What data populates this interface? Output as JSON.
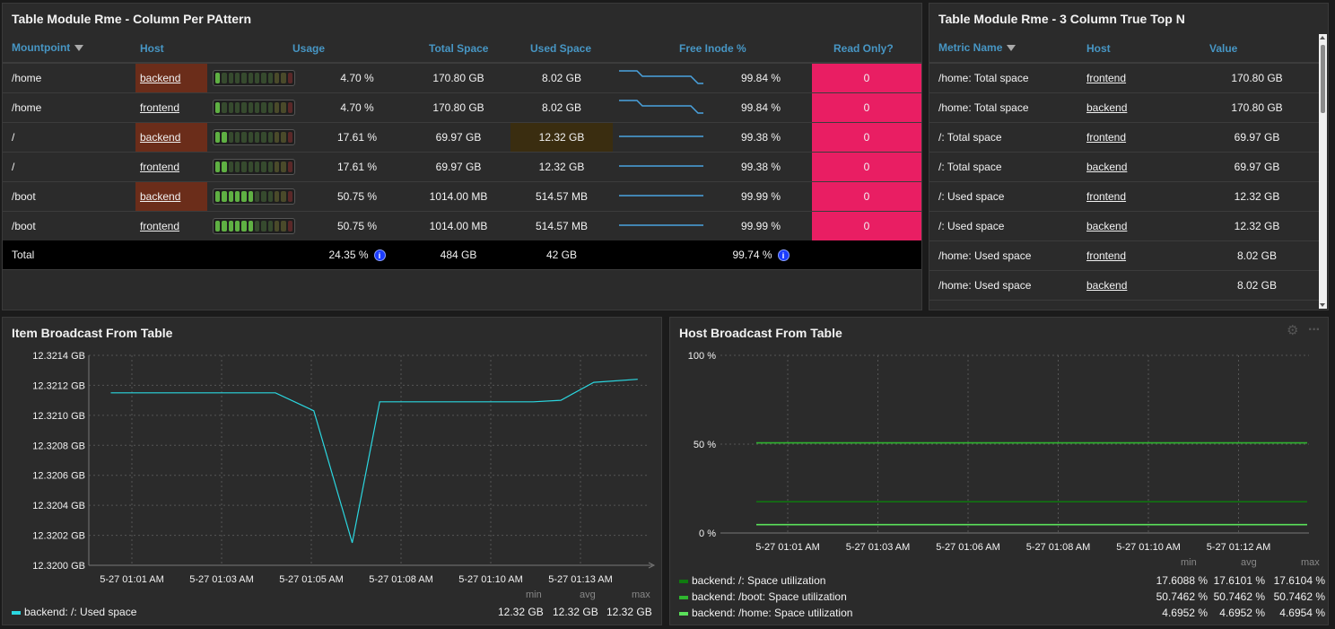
{
  "table1": {
    "title": "Table Module Rme - Column Per PAttern",
    "headers": [
      "Mountpoint",
      "Host",
      "Usage",
      "Total Space",
      "Used Space",
      "Free Inode %",
      "Read Only?"
    ],
    "rows": [
      {
        "mount": "/home",
        "host": "backend",
        "usage": "4.70 %",
        "usage_fraction": 0.047,
        "total": "170.80 GB",
        "used": "8.02 GB",
        "inode": "99.84 %",
        "ro": "0"
      },
      {
        "mount": "/home",
        "host": "frontend",
        "usage": "4.70 %",
        "usage_fraction": 0.047,
        "total": "170.80 GB",
        "used": "8.02 GB",
        "inode": "99.84 %",
        "ro": "0"
      },
      {
        "mount": "/",
        "host": "backend",
        "usage": "17.61 %",
        "usage_fraction": 0.1761,
        "total": "69.97 GB",
        "used": "12.32 GB",
        "inode": "99.38 %",
        "ro": "0"
      },
      {
        "mount": "/",
        "host": "frontend",
        "usage": "17.61 %",
        "usage_fraction": 0.1761,
        "total": "69.97 GB",
        "used": "12.32 GB",
        "inode": "99.38 %",
        "ro": "0"
      },
      {
        "mount": "/boot",
        "host": "backend",
        "usage": "50.75 %",
        "usage_fraction": 0.5075,
        "total": "1014.00 MB",
        "used": "514.57 MB",
        "inode": "99.99 %",
        "ro": "0"
      },
      {
        "mount": "/boot",
        "host": "frontend",
        "usage": "50.75 %",
        "usage_fraction": 0.5075,
        "total": "1014.00 MB",
        "used": "514.57 MB",
        "inode": "99.99 %",
        "ro": "0"
      }
    ],
    "total": {
      "label": "Total",
      "usage": "24.35 %",
      "total": "484 GB",
      "used": "42 GB",
      "inode": "99.74 %"
    },
    "info_glyph": "i",
    "colors": {
      "host_highlight": "#6b2d1a",
      "used_highlight": "#3a2d10",
      "readonly": "#e91e63",
      "header": "#4796c4",
      "sparkline": "#4aa3df"
    }
  },
  "table2": {
    "title": "Table Module Rme - 3 Column True Top N",
    "headers": [
      "Metric Name",
      "Host",
      "Value"
    ],
    "rows": [
      {
        "metric": "/home: Total space",
        "host": "frontend",
        "value": "170.80 GB"
      },
      {
        "metric": "/home: Total space",
        "host": "backend",
        "value": "170.80 GB"
      },
      {
        "metric": "/: Total space",
        "host": "frontend",
        "value": "69.97 GB"
      },
      {
        "metric": "/: Total space",
        "host": "backend",
        "value": "69.97 GB"
      },
      {
        "metric": "/: Used space",
        "host": "frontend",
        "value": "12.32 GB"
      },
      {
        "metric": "/: Used space",
        "host": "backend",
        "value": "12.32 GB"
      },
      {
        "metric": "/home: Used space",
        "host": "frontend",
        "value": "8.02 GB"
      },
      {
        "metric": "/home: Used space",
        "host": "backend",
        "value": "8.02 GB"
      }
    ]
  },
  "chart1": {
    "title": "Item Broadcast From Table",
    "legend_headers": {
      "min": "min",
      "avg": "avg",
      "max": "max"
    },
    "legend": [
      {
        "name": "backend: /: Used space",
        "color": "#2bd7e0",
        "min": "12.32 GB",
        "avg": "12.32 GB",
        "max": "12.32 GB"
      }
    ]
  },
  "chart2": {
    "title": "Host Broadcast From Table",
    "legend_headers": {
      "min": "min",
      "avg": "avg",
      "max": "max"
    },
    "legend": [
      {
        "name": "backend: /: Space utilization",
        "color": "#0f7a0f",
        "min": "17.6088 %",
        "avg": "17.6101 %",
        "max": "17.6104 %"
      },
      {
        "name": "backend: /boot: Space utilization",
        "color": "#2fb52f",
        "min": "50.7462 %",
        "avg": "50.7462 %",
        "max": "50.7462 %"
      },
      {
        "name": "backend: /home: Space utilization",
        "color": "#5ae05a",
        "min": "4.6952 %",
        "avg": "4.6952 %",
        "max": "4.6954 %"
      }
    ],
    "icons": [
      "gear-icon",
      "more-icon"
    ]
  },
  "chart_data": [
    {
      "type": "line",
      "title": "Item Broadcast From Table",
      "xlabel": "",
      "ylabel": "",
      "ylim": [
        12.32,
        12.3214
      ],
      "yticks": [
        "12.3214 GB",
        "12.3212 GB",
        "12.3210 GB",
        "12.3208 GB",
        "12.3206 GB",
        "12.3204 GB",
        "12.3202 GB",
        "12.3200 GB"
      ],
      "xticks": [
        "5-27 01:01 AM",
        "5-27 01:03 AM",
        "5-27 01:05 AM",
        "5-27 01:08 AM",
        "5-27 01:10 AM",
        "5-27 01:13 AM"
      ],
      "x": [
        "5-27 00:59:40",
        "5-27 01:04:40",
        "5-27 01:05:50",
        "5-27 01:07:00",
        "5-27 01:07:50",
        "5-27 01:12:30",
        "5-27 01:13:20",
        "5-27 01:14:20",
        "5-27 01:15:40"
      ],
      "series": [
        {
          "name": "backend: /: Used space",
          "color": "#2bd7e0",
          "values": [
            12.32115,
            12.32115,
            12.32103,
            12.32015,
            12.32109,
            12.32109,
            12.3211,
            12.32122,
            12.32124
          ]
        }
      ],
      "grid": true
    },
    {
      "type": "line",
      "title": "Host Broadcast From Table",
      "xlabel": "",
      "ylabel": "",
      "ylim": [
        0,
        100
      ],
      "yticks": [
        "100 %",
        "50 %",
        "0 %"
      ],
      "xticks": [
        "5-27 01:01 AM",
        "5-27 01:03 AM",
        "5-27 01:06 AM",
        "5-27 01:08 AM",
        "5-27 01:10 AM",
        "5-27 01:12 AM"
      ],
      "series": [
        {
          "name": "backend: /: Space utilization",
          "color": "#0f7a0f",
          "values": [
            17.61,
            17.61
          ]
        },
        {
          "name": "backend: /boot: Space utilization",
          "color": "#2fb52f",
          "values": [
            50.75,
            50.75
          ]
        },
        {
          "name": "backend: /home: Space utilization",
          "color": "#5ae05a",
          "values": [
            4.7,
            4.7
          ]
        }
      ],
      "grid": true
    }
  ]
}
